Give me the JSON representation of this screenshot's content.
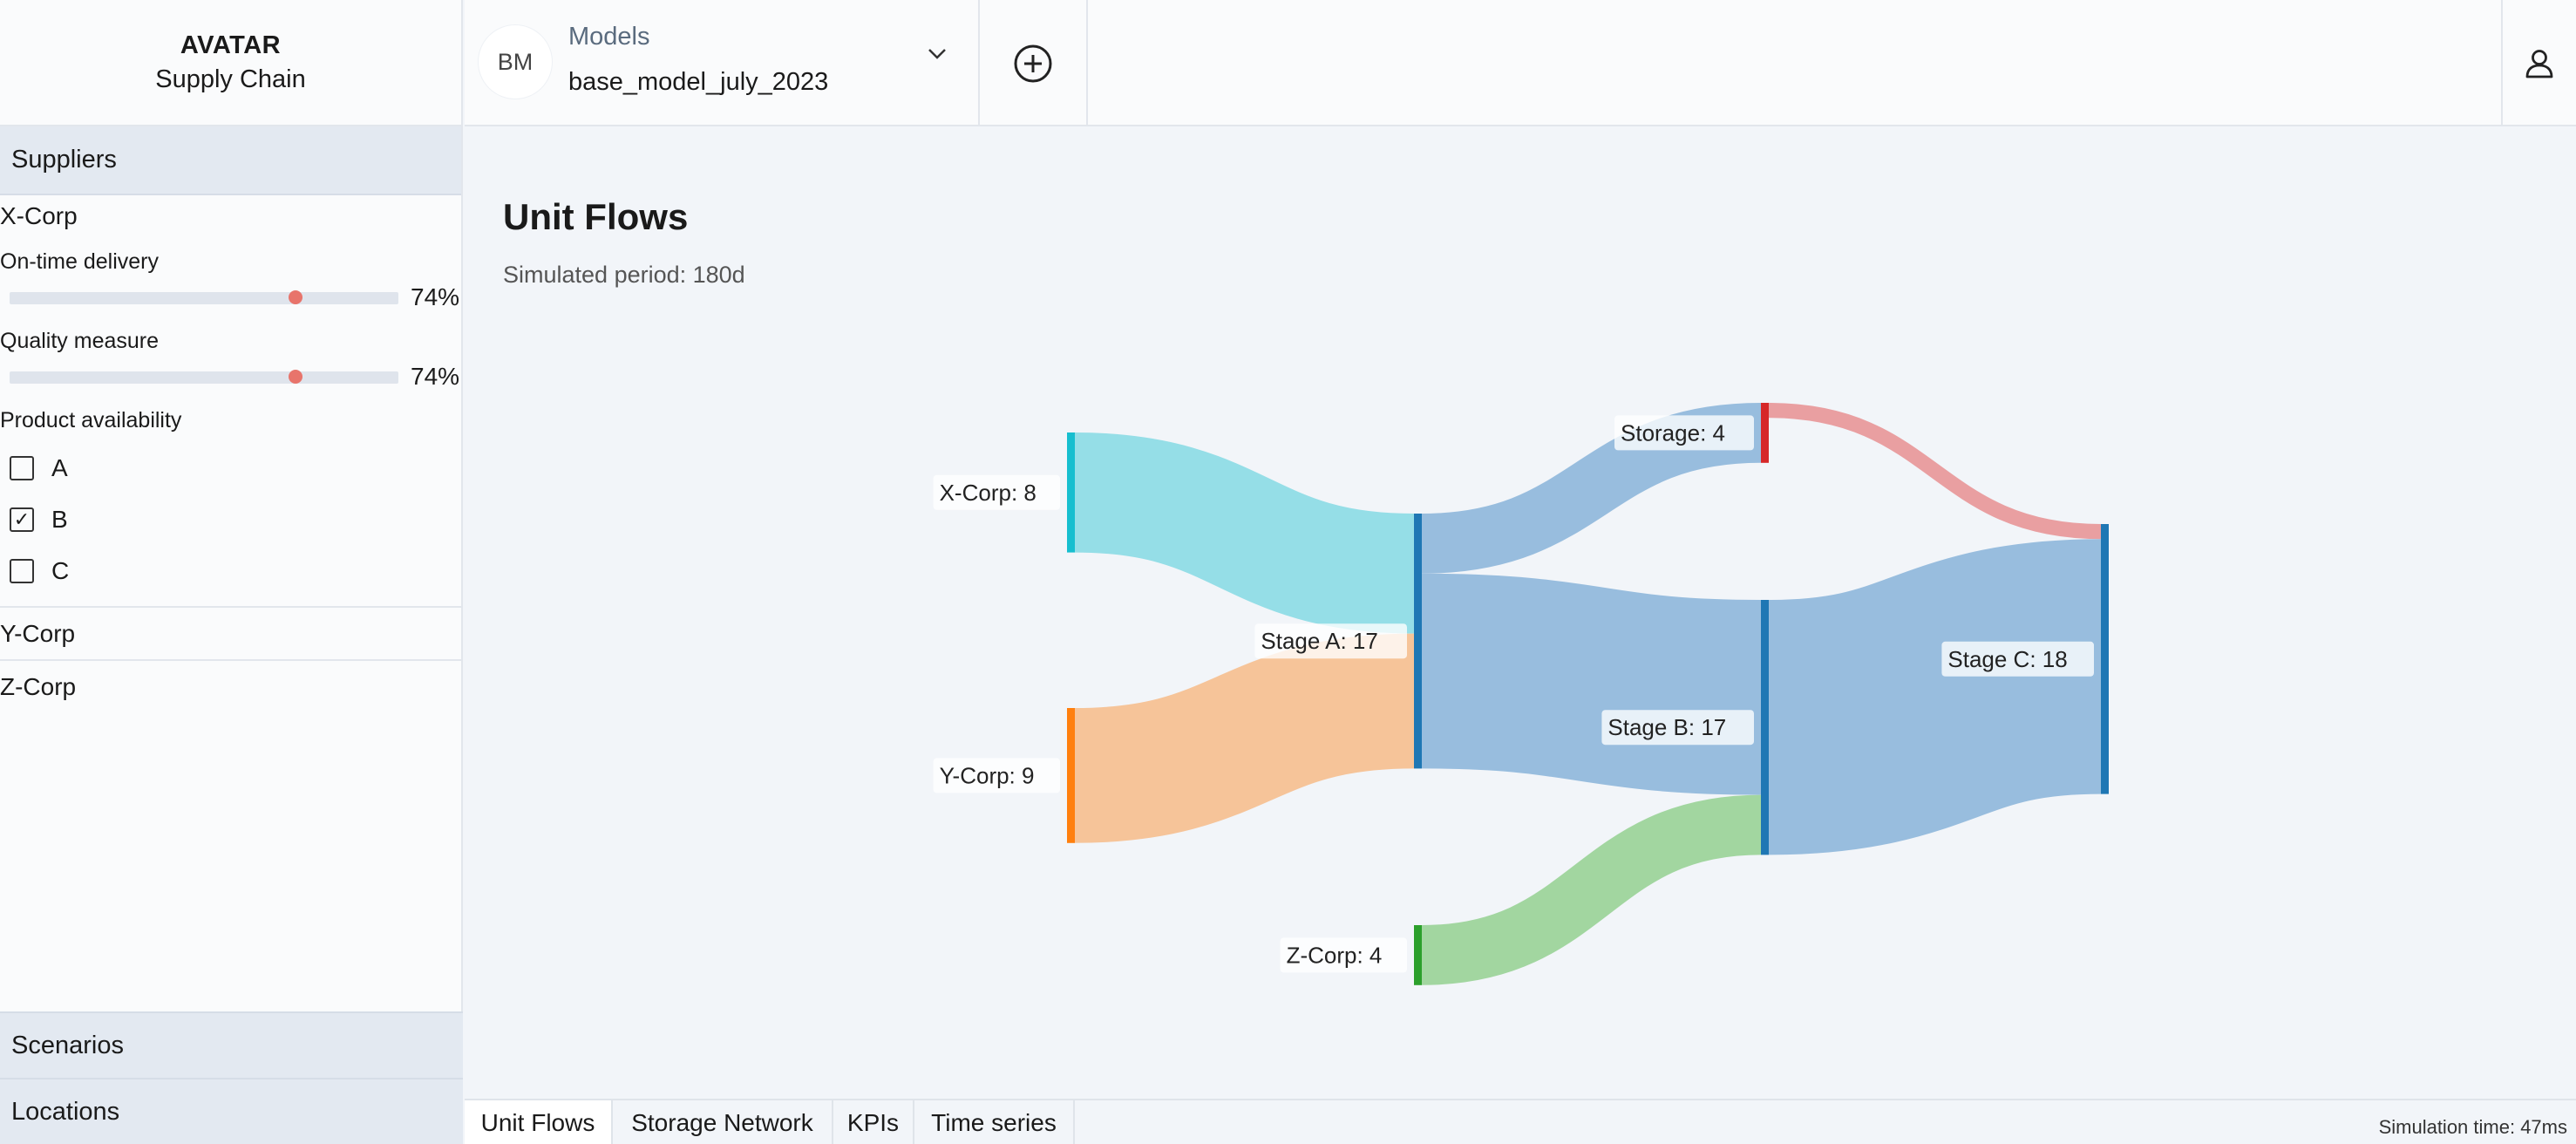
{
  "brand": {
    "title": "AVATAR",
    "subtitle": "Supply Chain"
  },
  "sidebar": {
    "suppliers_header": "Suppliers",
    "supplier_expanded": {
      "name": "X-Corp",
      "metrics": [
        {
          "label": "On-time delivery",
          "value": 0.74,
          "display": "74%"
        },
        {
          "label": "Quality measure",
          "value": 0.74,
          "display": "74%"
        }
      ],
      "availability_label": "Product availability",
      "products": [
        {
          "label": "A",
          "checked": false
        },
        {
          "label": "B",
          "checked": true
        },
        {
          "label": "C",
          "checked": false
        }
      ]
    },
    "other_suppliers": [
      "Y-Corp",
      "Z-Corp"
    ],
    "scenarios_header": "Scenarios",
    "locations_header": "Locations"
  },
  "topbar": {
    "avatar_initials": "BM",
    "models_label": "Models",
    "model_name": "base_model_july_2023",
    "icons": [
      "chevron-down-icon",
      "add-circle-icon",
      "user-icon"
    ]
  },
  "main": {
    "title": "Unit Flows",
    "subtitle": "Simulated period: 180d"
  },
  "chart_data": {
    "type": "sankey",
    "nodes": [
      {
        "id": "xcorp",
        "label": "X-Corp: 8",
        "value": 8,
        "color": "#17becf"
      },
      {
        "id": "ycorp",
        "label": "Y-Corp: 9",
        "value": 9,
        "color": "#ff7f0e"
      },
      {
        "id": "zcorp",
        "label": "Z-Corp: 4",
        "value": 4,
        "color": "#2ca02c"
      },
      {
        "id": "stageA",
        "label": "Stage A: 17",
        "value": 17,
        "color": "#1f77b4"
      },
      {
        "id": "storage",
        "label": "Storage: 4",
        "value": 4,
        "color": "#d62728"
      },
      {
        "id": "stageB",
        "label": "Stage B: 17",
        "value": 17,
        "color": "#1f77b4"
      },
      {
        "id": "stageC",
        "label": "Stage C: 18",
        "value": 18,
        "color": "#1f77b4"
      }
    ],
    "links": [
      {
        "source": "xcorp",
        "target": "stageA",
        "value": 8,
        "color": "#8fdce6"
      },
      {
        "source": "ycorp",
        "target": "stageA",
        "value": 9,
        "color": "#f5c193"
      },
      {
        "source": "stageA",
        "target": "storage",
        "value": 4,
        "color": "#92b9dc"
      },
      {
        "source": "stageA",
        "target": "stageB",
        "value": 13,
        "color": "#92b9dc"
      },
      {
        "source": "zcorp",
        "target": "stageB",
        "value": 4,
        "color": "#9dd49b"
      },
      {
        "source": "storage",
        "target": "stageC",
        "value": 1,
        "color": "#e89a9c"
      },
      {
        "source": "stageB",
        "target": "stageC",
        "value": 17,
        "color": "#92b9dc"
      }
    ]
  },
  "tabs": [
    {
      "label": "Unit Flows",
      "active": true
    },
    {
      "label": "Storage Network",
      "active": false
    },
    {
      "label": "KPIs",
      "active": false
    },
    {
      "label": "Time series",
      "active": false
    }
  ],
  "status": {
    "simulation_time": "Simulation time: 47ms"
  }
}
